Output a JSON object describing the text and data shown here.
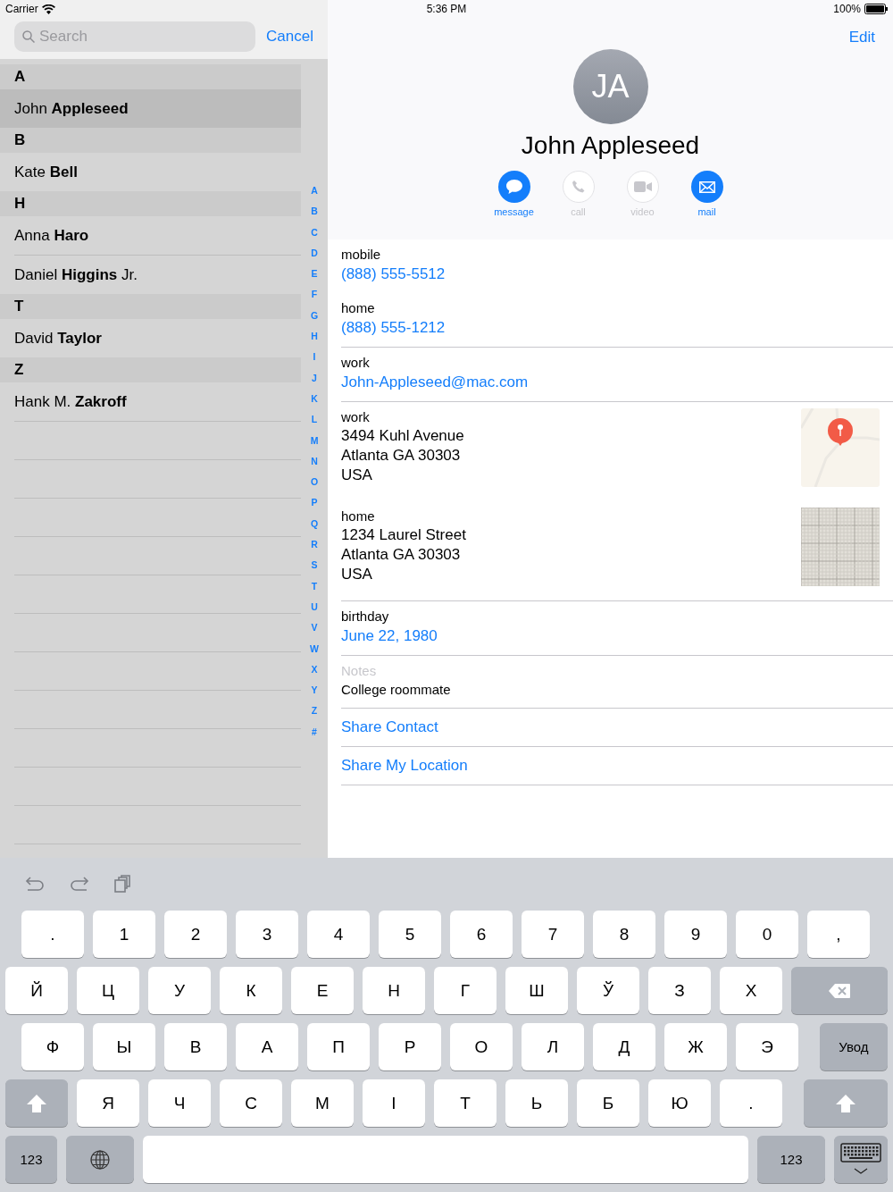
{
  "status_bar": {
    "carrier": "Carrier",
    "time": "5:36 PM",
    "battery": "100%"
  },
  "search": {
    "placeholder": "Search",
    "cancel": "Cancel"
  },
  "sections": [
    {
      "letter": "A",
      "rows": [
        {
          "name": "John **Appleseed**",
          "selected": true
        }
      ]
    },
    {
      "letter": "B",
      "rows": [
        {
          "name": "Kate **Bell**",
          "selected": false
        }
      ]
    },
    {
      "letter": "H",
      "rows": [
        {
          "name": "Anna **Haro**",
          "selected": false
        },
        {
          "name": "Daniel **Higgins** Jr.",
          "selected": false
        }
      ]
    },
    {
      "letter": "T",
      "rows": [
        {
          "name": "David **Taylor**",
          "selected": false
        }
      ]
    },
    {
      "letter": "Z",
      "rows": [
        {
          "name": "Hank M. **Zakroff**",
          "selected": false
        }
      ]
    }
  ],
  "index": [
    "A",
    "B",
    "C",
    "D",
    "E",
    "F",
    "G",
    "H",
    "I",
    "J",
    "K",
    "L",
    "M",
    "N",
    "O",
    "P",
    "Q",
    "R",
    "S",
    "T",
    "U",
    "V",
    "W",
    "X",
    "Y",
    "Z",
    "#"
  ],
  "detail": {
    "edit": "Edit",
    "initials": "JA",
    "name": "John Appleseed",
    "actions": [
      {
        "kind": "message",
        "label": "message",
        "enabled": true
      },
      {
        "kind": "call",
        "label": "call",
        "enabled": false
      },
      {
        "kind": "video",
        "label": "video",
        "enabled": false
      },
      {
        "kind": "mail",
        "label": "mail",
        "enabled": true
      }
    ],
    "groups": [
      [
        {
          "kind": "link",
          "label": "mobile",
          "value": "(888) 555-5512"
        },
        {
          "kind": "link",
          "label": "home",
          "value": "(888) 555-1212"
        }
      ],
      [
        {
          "kind": "link",
          "label": "work",
          "value": "John-Appleseed@mac.com"
        }
      ],
      [
        {
          "kind": "address",
          "label": "work",
          "lines": [
            "3494 Kuhl Avenue",
            "Atlanta GA 30303",
            "USA"
          ]
        },
        {
          "kind": "address",
          "label": "home",
          "lines": [
            "1234 Laurel Street",
            "Atlanta GA 30303",
            "USA"
          ]
        }
      ],
      [
        {
          "kind": "link",
          "label": "birthday",
          "value": "June 22, 1980"
        }
      ],
      [
        {
          "kind": "note",
          "label": "Notes",
          "value": "College roommate"
        }
      ],
      [
        {
          "kind": "action",
          "value": "Share Contact"
        }
      ],
      [
        {
          "kind": "action",
          "value": "Share My Location"
        }
      ]
    ]
  },
  "keyboard": {
    "rows": [
      [
        {
          "kind": "char",
          "label": "."
        },
        {
          "kind": "char",
          "label": "1"
        },
        {
          "kind": "char",
          "label": "2"
        },
        {
          "kind": "char",
          "label": "3"
        },
        {
          "kind": "char",
          "label": "4"
        },
        {
          "kind": "char",
          "label": "5"
        },
        {
          "kind": "char",
          "label": "6"
        },
        {
          "kind": "char",
          "label": "7"
        },
        {
          "kind": "char",
          "label": "8"
        },
        {
          "kind": "char",
          "label": "9"
        },
        {
          "kind": "char",
          "label": "0"
        },
        {
          "kind": "char",
          "label": ","
        }
      ],
      [
        {
          "kind": "char",
          "label": "Й"
        },
        {
          "kind": "char",
          "label": "Ц"
        },
        {
          "kind": "char",
          "label": "У"
        },
        {
          "kind": "char",
          "label": "К"
        },
        {
          "kind": "char",
          "label": "Е"
        },
        {
          "kind": "char",
          "label": "Н"
        },
        {
          "kind": "char",
          "label": "Г"
        },
        {
          "kind": "char",
          "label": "Ш"
        },
        {
          "kind": "char",
          "label": "Ў"
        },
        {
          "kind": "char",
          "label": "З"
        },
        {
          "kind": "char",
          "label": "Х"
        },
        {
          "kind": "backspace"
        }
      ],
      [
        {
          "kind": "char",
          "label": "Ф"
        },
        {
          "kind": "char",
          "label": "Ы"
        },
        {
          "kind": "char",
          "label": "В"
        },
        {
          "kind": "char",
          "label": "А"
        },
        {
          "kind": "char",
          "label": "П"
        },
        {
          "kind": "char",
          "label": "Р"
        },
        {
          "kind": "char",
          "label": "О"
        },
        {
          "kind": "char",
          "label": "Л"
        },
        {
          "kind": "char",
          "label": "Д"
        },
        {
          "kind": "char",
          "label": "Ж"
        },
        {
          "kind": "char",
          "label": "Э"
        },
        {
          "kind": "return",
          "label": "Увод"
        }
      ],
      [
        {
          "kind": "shift"
        },
        {
          "kind": "char",
          "label": "Я"
        },
        {
          "kind": "char",
          "label": "Ч"
        },
        {
          "kind": "char",
          "label": "С"
        },
        {
          "kind": "char",
          "label": "М"
        },
        {
          "kind": "char",
          "label": "І"
        },
        {
          "kind": "char",
          "label": "Т"
        },
        {
          "kind": "char",
          "label": "Ь"
        },
        {
          "kind": "char",
          "label": "Б"
        },
        {
          "kind": "char",
          "label": "Ю"
        },
        {
          "kind": "char",
          "label": "."
        },
        {
          "kind": "shift"
        }
      ],
      [
        {
          "kind": "numbers",
          "label": "123"
        },
        {
          "kind": "globe"
        },
        {
          "kind": "space"
        },
        {
          "kind": "numbers",
          "label": "123"
        },
        {
          "kind": "dismiss"
        }
      ]
    ]
  }
}
